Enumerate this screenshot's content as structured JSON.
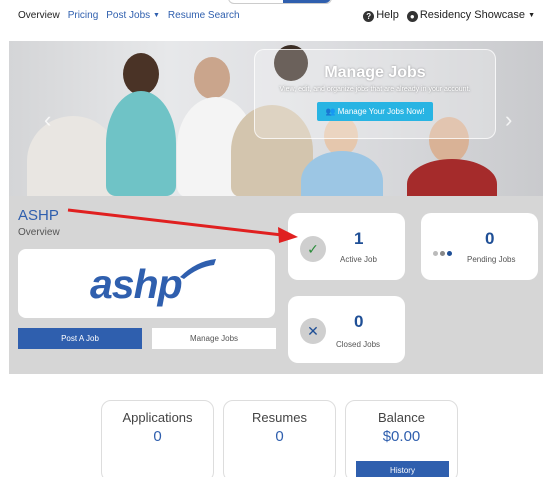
{
  "nav": {
    "items": [
      "Overview",
      "Pricing",
      "Post Jobs",
      "Resume Search"
    ],
    "help": "Help",
    "account": "Residency Showcase"
  },
  "hero": {
    "title": "Manage Jobs",
    "subtitle": "View, edit, and organize jobs that are already in your account.",
    "button": "Manage Your Jobs Now!"
  },
  "company": {
    "name": "ASHP",
    "section": "Overview",
    "logo_text": "ashp",
    "post_button": "Post A Job",
    "manage_button": "Manage Jobs"
  },
  "stats": {
    "active": {
      "value": "1",
      "label": "Active Job"
    },
    "pending": {
      "value": "0",
      "label": "Pending Jobs"
    },
    "closed": {
      "value": "0",
      "label": "Closed Jobs"
    }
  },
  "summary": {
    "applications": {
      "title": "Applications",
      "value": "0"
    },
    "resumes": {
      "title": "Resumes",
      "value": "0"
    },
    "balance": {
      "title": "Balance",
      "value": "$0.00",
      "button": "History"
    }
  },
  "colors": {
    "brand_blue": "#2f5fae",
    "hero_button": "#28b4e3",
    "annotation_arrow": "#e02020"
  },
  "icons": {
    "help": "question-circle-icon",
    "account": "user-circle-icon",
    "active": "checkmark-icon",
    "pending": "dots-icon",
    "closed": "x-icon"
  }
}
